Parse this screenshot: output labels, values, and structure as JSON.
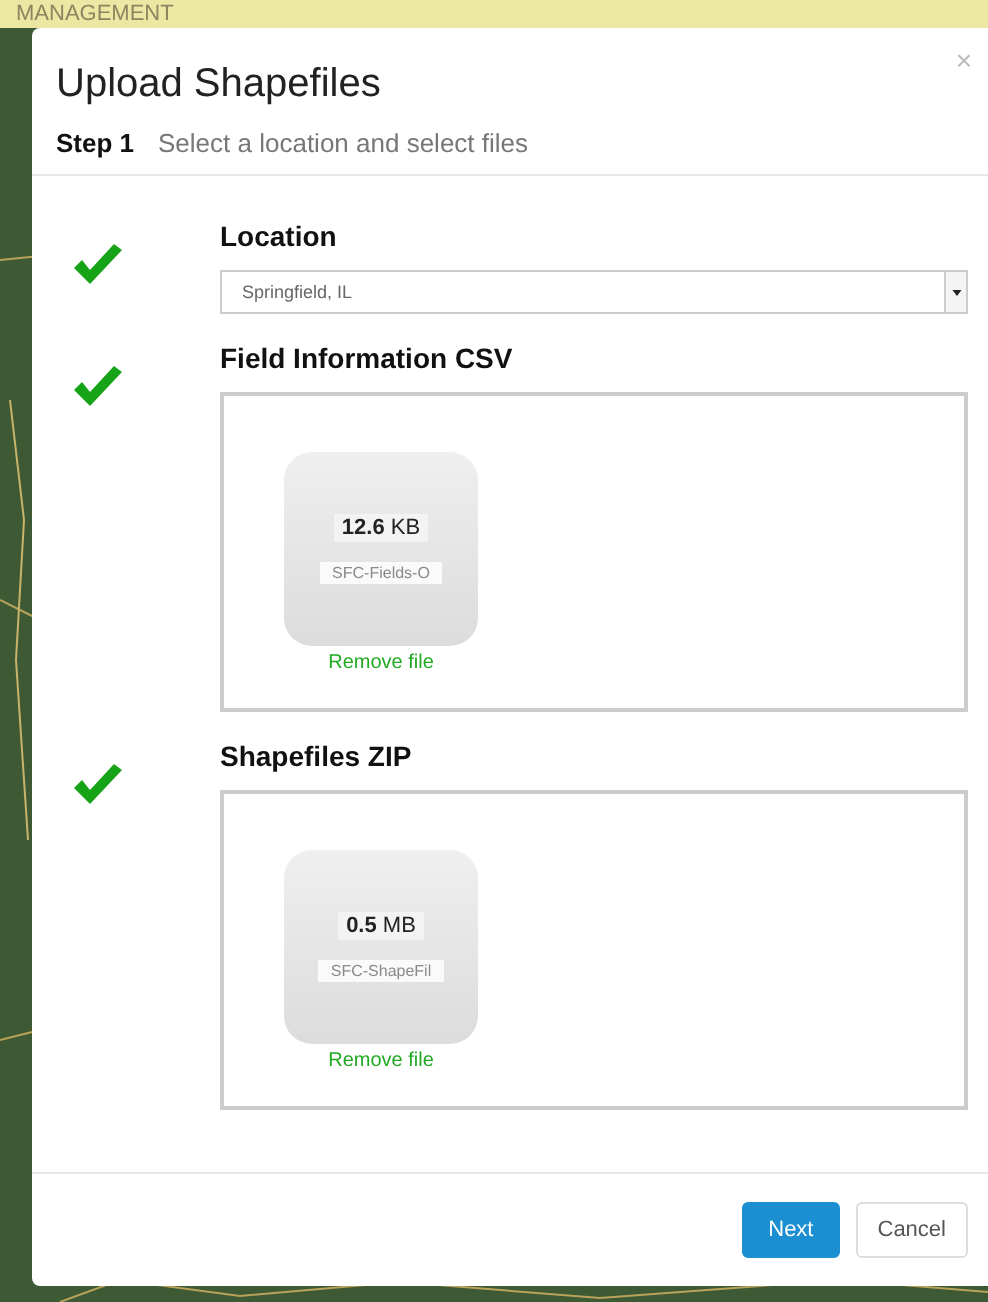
{
  "background": {
    "header": "MANAGEMENT",
    "kind": "picture"
  },
  "dialog": {
    "title": "Upload Shapefiles",
    "close": "×",
    "step": "Step 1",
    "step_text": "Select a location and select files"
  },
  "sections": [
    {
      "kind": "select",
      "label": "Location",
      "complete": true,
      "value": "Springfield, IL"
    },
    {
      "kind": "file",
      "label": "Field Information CSV",
      "complete": true,
      "size": "**12.6** KB",
      "filename": "SFC-Fields-O",
      "remove": "Remove file"
    },
    {
      "kind": "file",
      "label": "Shapefiles ZIP",
      "complete": true,
      "size": "**0.5** MB",
      "filename": "SFC-ShapeFil",
      "remove": "Remove file"
    }
  ],
  "buttons": [
    {
      "label": "Next",
      "primary": true
    },
    {
      "label": "Cancel",
      "primary": false
    }
  ]
}
